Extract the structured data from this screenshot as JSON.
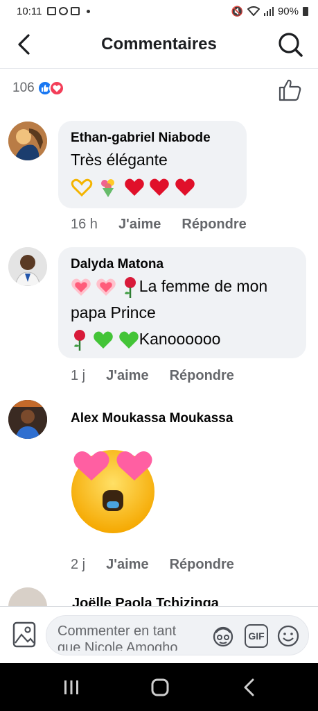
{
  "status_bar": {
    "time": "10:11",
    "battery": "90%"
  },
  "header": {
    "title": "Commentaires"
  },
  "reactions": {
    "count": "106"
  },
  "comments": [
    {
      "author": "Ethan-gabriel Niabode",
      "text": "Très élégante",
      "time": "16 h",
      "like": "J'aime",
      "reply": "Répondre"
    },
    {
      "author": "Dalyda Matona",
      "text_line1": "La femme de mon",
      "text_line2": "papa Prince",
      "text_line3": "Kanoooooo",
      "time": "1 j",
      "like": "J'aime",
      "reply": "Répondre"
    },
    {
      "author": "Alex Moukassa Moukassa",
      "time": "2 j",
      "like": "J'aime",
      "reply": "Répondre"
    },
    {
      "author": "Joëlle Paola Tchizinga"
    }
  ],
  "composer": {
    "placeholder": "Commenter en tant que Nicole Amogho",
    "gif_label": "GIF"
  },
  "colors": {
    "accent": "#1877f2",
    "bubble": "#f0f2f5",
    "love": "#f33e58"
  }
}
